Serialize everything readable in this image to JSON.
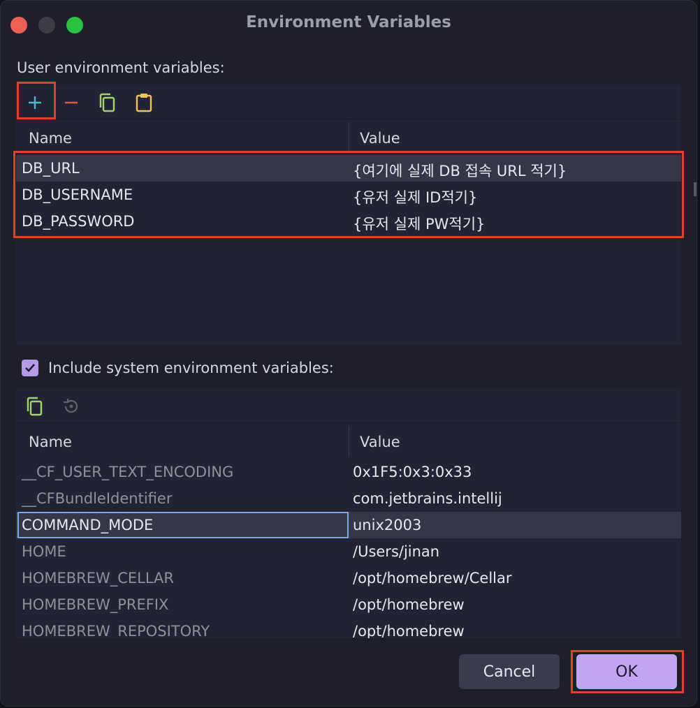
{
  "window": {
    "title": "Environment Variables"
  },
  "user_section": {
    "label": "User environment variables:",
    "toolbar": {
      "add": "add-icon",
      "remove": "remove-icon",
      "copy": "copy-icon",
      "paste": "paste-icon"
    },
    "columns": {
      "name": "Name",
      "value": "Value"
    },
    "rows": [
      {
        "name": "DB_URL",
        "value": "{여기에 실제 DB 접속 URL 적기}"
      },
      {
        "name": "DB_USERNAME",
        "value": "{유저 실제 ID적기}"
      },
      {
        "name": "DB_PASSWORD",
        "value": "{유저 실제 PW적기}"
      }
    ]
  },
  "system_section": {
    "checkbox_label": "Include system environment variables:",
    "checked": true,
    "toolbar": {
      "copy": "copy-icon",
      "reset": "reset-icon"
    },
    "columns": {
      "name": "Name",
      "value": "Value"
    },
    "rows": [
      {
        "name": "__CF_USER_TEXT_ENCODING",
        "value": "0x1F5:0x3:0x33"
      },
      {
        "name": "__CFBundleIdentifier",
        "value": "com.jetbrains.intellij"
      },
      {
        "name": "COMMAND_MODE",
        "value": "unix2003"
      },
      {
        "name": "HOME",
        "value": "/Users/jinan"
      },
      {
        "name": "HOMEBREW_CELLAR",
        "value": "/opt/homebrew/Cellar"
      },
      {
        "name": "HOMEBREW_PREFIX",
        "value": "/opt/homebrew"
      },
      {
        "name": "HOMEBREW_REPOSITORY",
        "value": "/opt/homebrew"
      }
    ]
  },
  "buttons": {
    "cancel": "Cancel",
    "ok": "OK"
  },
  "colors": {
    "accent": "#c2a5f2",
    "highlight": "#e0412f",
    "add_icon": "#4fb3d6",
    "remove_icon": "#e0564d",
    "copy_icon": "#9fd46f",
    "paste_icon": "#f0c25a"
  }
}
